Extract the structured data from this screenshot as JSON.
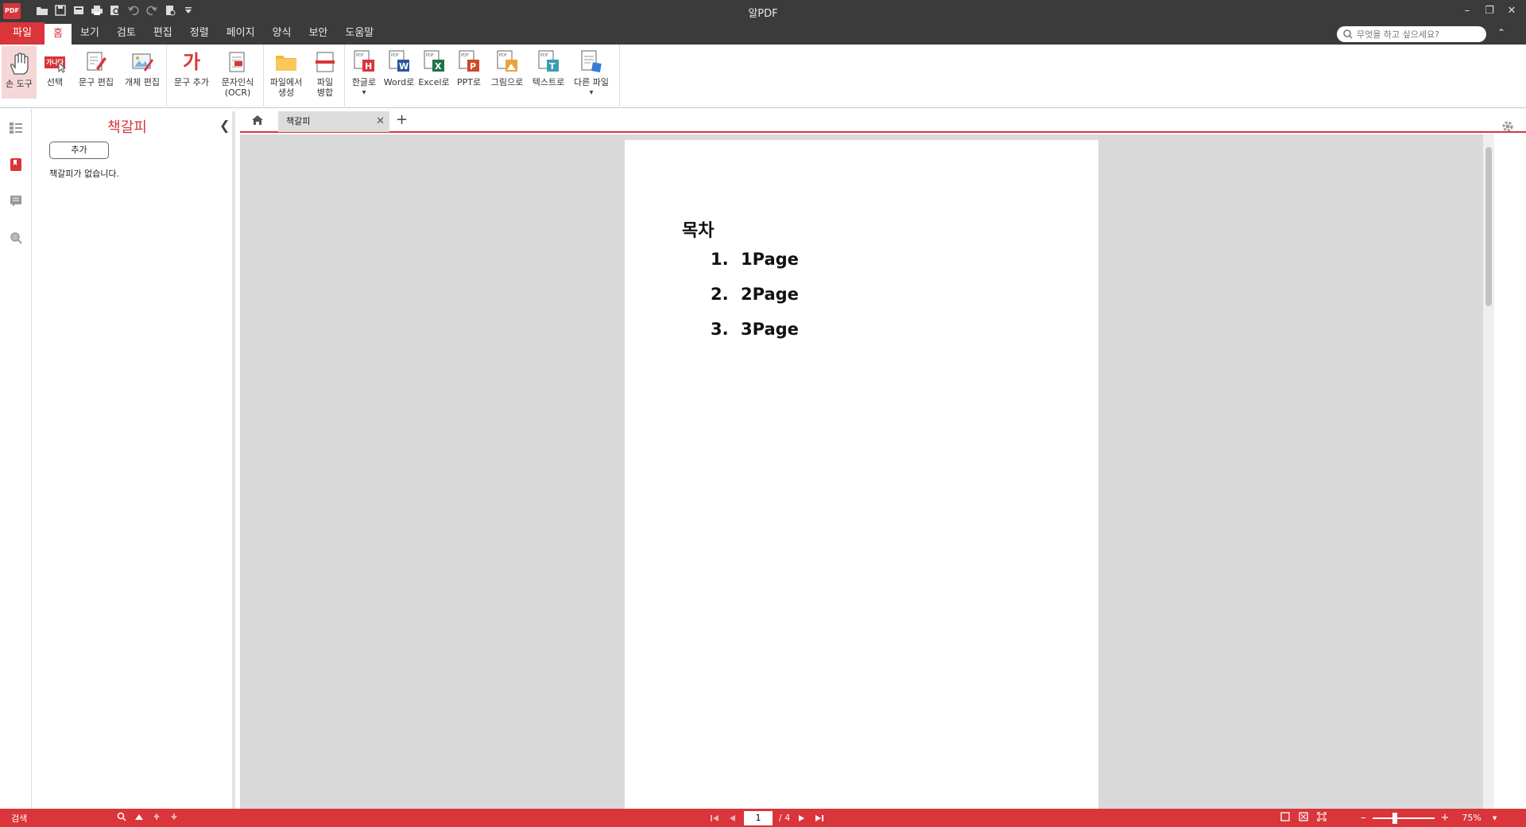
{
  "titlebar": {
    "logo_text": "PDF",
    "title": "알PDF",
    "quick_access": [
      "open-folder-icon",
      "save-icon",
      "save-as-icon",
      "print-icon",
      "print-preview-icon",
      "undo-icon",
      "redo-icon",
      "new-document-icon",
      "customize-dropdown-icon"
    ],
    "window_controls": {
      "minimize": "–",
      "restore": "❐",
      "close": "✕"
    }
  },
  "menubar": {
    "file_label": "파일",
    "tabs": [
      "홈",
      "보기",
      "검토",
      "편집",
      "정렬",
      "페이지",
      "양식",
      "보안",
      "도움말"
    ],
    "active_tab": "홈",
    "help_search_placeholder": "무엇을 하고 싶으세요?",
    "collapse_symbol": "⌃"
  },
  "ribbon": {
    "tools": [
      {
        "label": "손 도구",
        "icon": "hand-icon"
      },
      {
        "label": "선택",
        "icon": "select-text-icon",
        "icon_text": "가나다"
      },
      {
        "label": "문구 편집",
        "icon": "edit-text-icon"
      },
      {
        "label": "개체 편집",
        "icon": "edit-object-icon"
      }
    ],
    "content": [
      {
        "label": "문구 추가",
        "icon": "add-text-icon",
        "icon_text": "가"
      },
      {
        "label": "문자인식\n(OCR)",
        "icon": "ocr-icon"
      }
    ],
    "create": [
      {
        "label": "파일에서\n생성",
        "icon": "create-from-file-icon"
      },
      {
        "label": "파일\n병합",
        "icon": "merge-files-icon"
      }
    ],
    "convert": [
      {
        "label": "한글로",
        "icon": "hwp-icon",
        "badge": "H",
        "color": "#d9353a",
        "dropdown": true
      },
      {
        "label": "Word로",
        "icon": "word-icon",
        "badge": "W",
        "color": "#2b579a"
      },
      {
        "label": "Excel로",
        "icon": "excel-icon",
        "badge": "X",
        "color": "#217346"
      },
      {
        "label": "PPT로",
        "icon": "ppt-icon",
        "badge": "P",
        "color": "#d24726"
      },
      {
        "label": "그림으로",
        "icon": "image-icon",
        "badge": "▲",
        "color": "#e8a33a"
      },
      {
        "label": "텍스트로",
        "icon": "text-icon",
        "badge": "T",
        "color": "#3a9db0"
      },
      {
        "label": "다른 파일",
        "icon": "other-file-icon",
        "badge": "",
        "color": "#3a7bd5",
        "dropdown": true
      }
    ]
  },
  "rail": [
    "thumbnails-icon",
    "bookmark-icon",
    "comment-icon",
    "search-icon"
  ],
  "bookmark_panel": {
    "title": "책갈피",
    "add_label": "추가",
    "empty_message": "책갈피가 없습니다."
  },
  "doc_tabs": {
    "tab_label": "책갈피",
    "close_symbol": "✕",
    "new_tab_symbol": "+"
  },
  "document": {
    "heading": "목차",
    "toc": [
      {
        "num": "1.",
        "text": "1Page"
      },
      {
        "num": "2.",
        "text": "2Page"
      },
      {
        "num": "3.",
        "text": "3Page"
      }
    ]
  },
  "statusbar": {
    "search_label": "검색",
    "current_page": "1",
    "total_pages": "/ 4",
    "zoom": "75%",
    "zoom_level": 0.35
  },
  "colors": {
    "accent": "#d9353a",
    "titlebar": "#3b3b3b",
    "viewer_bg": "#d9d9d9"
  }
}
